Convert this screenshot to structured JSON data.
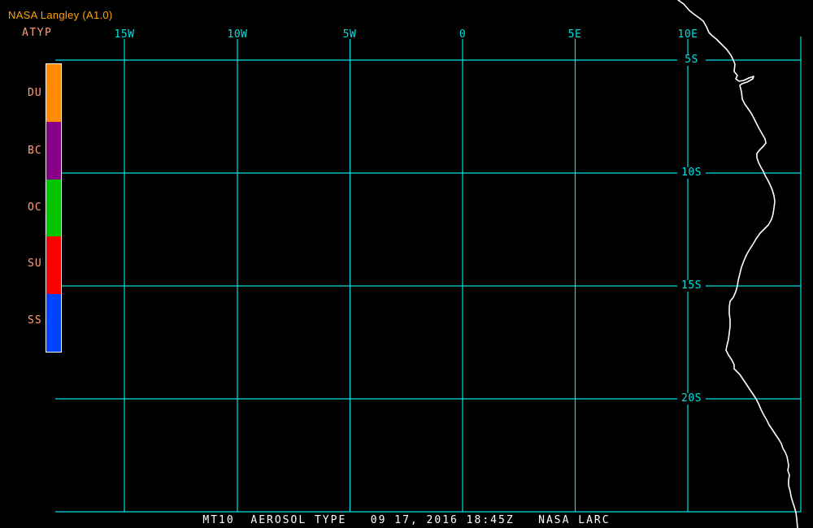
{
  "header": {
    "title": "NASA Langley (A1.0)",
    "product": "ATYP"
  },
  "map": {
    "lon_labels": [
      "15W",
      "10W",
      "5W",
      "0",
      "5E",
      "10E"
    ],
    "lat_labels": [
      "5S",
      "10S",
      "15S",
      "20S"
    ],
    "region": "west coast of southern Africa (Angola/Namibia)"
  },
  "legend": {
    "items": [
      {
        "label": "DU",
        "color": "#FF8C00"
      },
      {
        "label": "BC",
        "color": "#870087"
      },
      {
        "label": "OC",
        "color": "#00C400"
      },
      {
        "label": "SU",
        "color": "#FF0000"
      },
      {
        "label": "SS",
        "color": "#0044FF"
      }
    ]
  },
  "caption": "MT10  AEROSOL TYPE   09 17, 2016 18:45Z   NASA LARC",
  "colors": {
    "background": "#000000",
    "grid": "#00E0E0",
    "coastline": "#FFFFFF",
    "title_text": "#FFA500",
    "label_text": "#FFA07A",
    "caption_text": "#FFFFFF"
  }
}
